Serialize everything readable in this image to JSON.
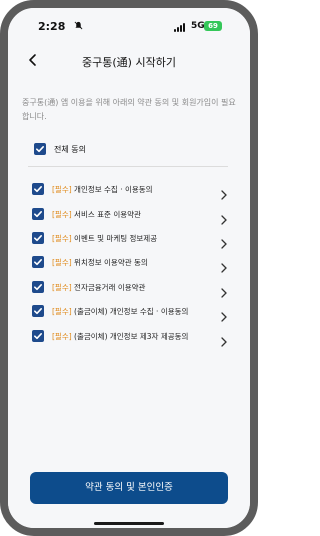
{
  "status_bar": {
    "time": "2:28",
    "network": "5G",
    "battery": "69"
  },
  "header": {
    "title": "중구통(通) 시작하기"
  },
  "description": "중구통(通) 앱 이용을 위해 아래의 약관 동의 및 회원가입이 필요합니다.",
  "agree_all": {
    "label": "전체 동의",
    "checked": true
  },
  "terms": [
    {
      "tag": "[필수]",
      "label": "개인정보 수집 · 이용동의",
      "checked": true
    },
    {
      "tag": "[필수]",
      "label": "서비스 표준 이용약관",
      "checked": true
    },
    {
      "tag": "[필수]",
      "label": "이벤트 및 마케팅 정보제공",
      "checked": true
    },
    {
      "tag": "[필수]",
      "label": "위치정보 이용약관 동의",
      "checked": true
    },
    {
      "tag": "[필수]",
      "label": "전자금융거래 이용약관",
      "checked": true
    },
    {
      "tag": "[필수]",
      "label": "(출금이체) 개인정보 수집 · 이용동의",
      "checked": true
    },
    {
      "tag": "[필수]",
      "label": "(출금이체) 개인정보 제3자 제공동의",
      "checked": true
    }
  ],
  "cta": {
    "label": "약관 동의 및 본인인증"
  },
  "colors": {
    "accent": "#0d4c8c",
    "checkbox": "#1e4a8c",
    "required_tag": "#e08a1a"
  }
}
